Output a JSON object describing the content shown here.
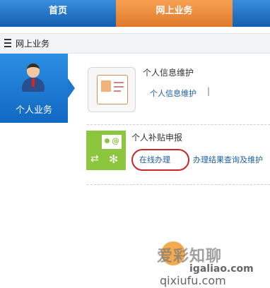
{
  "nav": {
    "tabs": [
      {
        "label": "首页",
        "active": false
      },
      {
        "label": "网上业务",
        "active": true
      }
    ],
    "active_color": "#e98a38",
    "base_color": "#1a6fc0"
  },
  "section": {
    "icon": "list-icon",
    "title": "网上业务"
  },
  "sidebar": {
    "icon": "user-avatar-icon",
    "label": "个人业务"
  },
  "services": [
    {
      "icon": "personal-card-icon",
      "title": "个人信息维护",
      "links": [
        "个人信息维护"
      ],
      "separator": "|"
    },
    {
      "icon": "subsidy-application-icon",
      "title": "个人补贴申报",
      "links": [
        "在线办理",
        "办理结果查询及维护"
      ],
      "highlight_color": "#c9252a"
    }
  ],
  "watermark": {
    "brand": "爱彩知聊",
    "url": "igaliao.com",
    "bottom": "qixiufu.com"
  }
}
